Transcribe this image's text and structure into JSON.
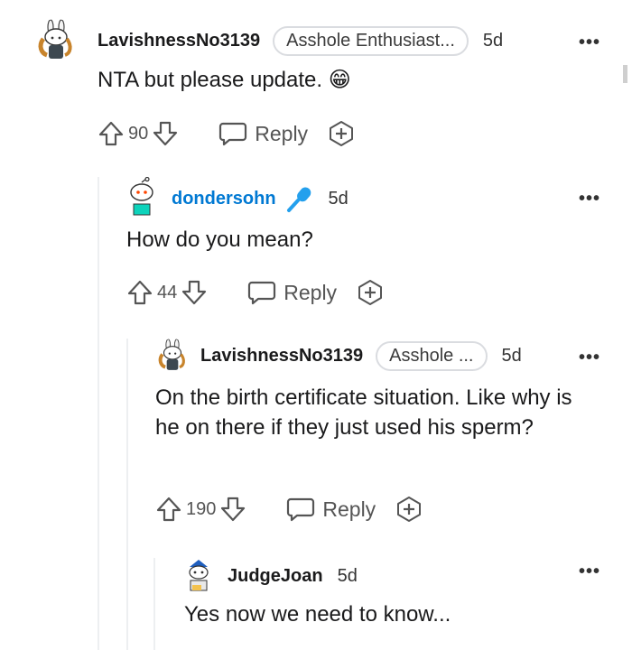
{
  "comments": [
    {
      "username": "LavishnessNo3139",
      "flair": "Asshole Enthusiast...",
      "time": "5d",
      "text": "NTA but please update.",
      "emoji": "😁",
      "votes": "90",
      "reply_label": "Reply"
    },
    {
      "username": "dondersohn",
      "time": "5d",
      "text": "How do you mean?",
      "votes": "44",
      "reply_label": "Reply"
    },
    {
      "username": "LavishnessNo3139",
      "flair": "Asshole ...",
      "time": "5d",
      "text": "On the birth certificate situation. Like why is he on there if they just used his sperm?",
      "votes": "190",
      "reply_label": "Reply"
    },
    {
      "username": "JudgeJoan",
      "time": "5d",
      "text": "Yes now we need to know..."
    }
  ],
  "icons": {
    "more": "more-options-icon",
    "upvote": "upvote-arrow-icon",
    "downvote": "downvote-arrow-icon",
    "reply": "reply-bubble-icon",
    "award": "award-icon",
    "mic": "microphone-icon"
  },
  "colors": {
    "username_blue": "#0079d3",
    "mic_blue": "#24a0ed",
    "text": "#1a1a1b",
    "muted": "#555555",
    "thread_line": "#edeff1"
  }
}
